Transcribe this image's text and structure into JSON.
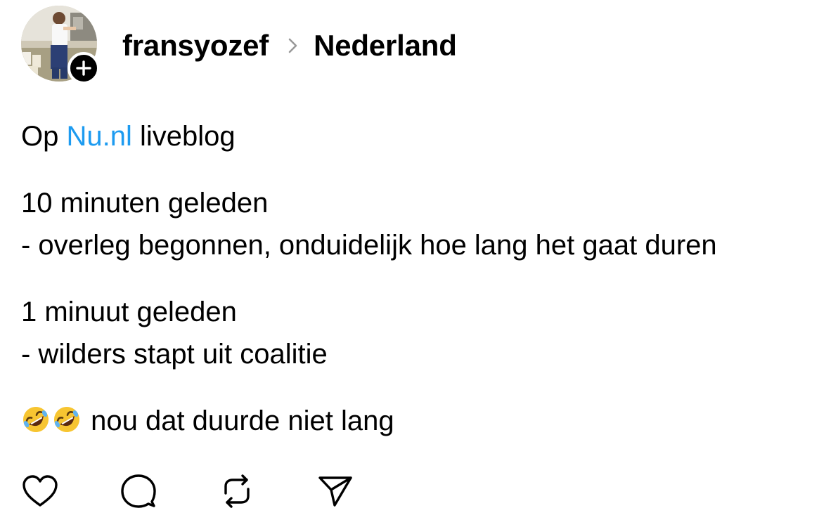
{
  "header": {
    "username": "fransyozef",
    "topic": "Nederland",
    "separator_icon": "chevron-right-icon",
    "follow_icon": "plus-icon"
  },
  "post": {
    "line1": {
      "prefix": "Op ",
      "link": "Nu.nl",
      "suffix": " liveblog"
    },
    "update1": {
      "time": "10 minuten geleden",
      "text": "- overleg begonnen, onduidelijk hoe lang het gaat duren"
    },
    "update2": {
      "time": "1 minuut geleden",
      "text": "- wilders stapt uit coalitie"
    },
    "closing": {
      "emoji_icon": "rolling-on-floor-laughing-emoji",
      "emoji_count": 2,
      "text": " nou dat duurde niet lang"
    }
  },
  "actions": [
    {
      "name": "like",
      "icon": "heart-icon"
    },
    {
      "name": "reply",
      "icon": "comment-bubble-icon"
    },
    {
      "name": "repost",
      "icon": "repost-icon"
    },
    {
      "name": "share",
      "icon": "send-icon"
    }
  ],
  "colors": {
    "link": "#1d9bf0",
    "text": "#000000",
    "icon": "#000000",
    "chevron": "#999999"
  }
}
